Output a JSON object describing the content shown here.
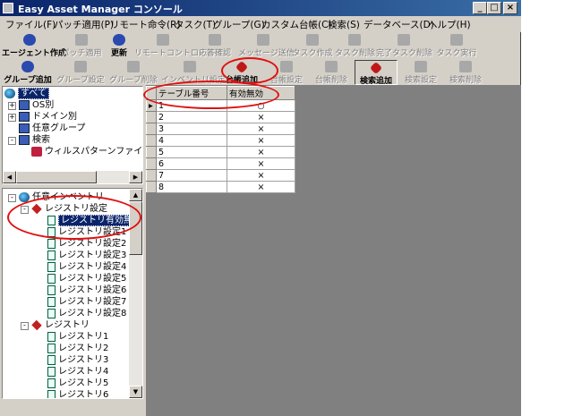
{
  "window": {
    "title": "Easy Asset Manager コンソール",
    "controls": {
      "minimize": "_",
      "maximize": "□",
      "close": "×"
    }
  },
  "menu": [
    {
      "label": "ファイル(F)"
    },
    {
      "label": "パッチ適用(P)"
    },
    {
      "label": "リモート命令(R)"
    },
    {
      "label": "タスク(T)"
    },
    {
      "label": "グループ(G)"
    },
    {
      "label": "カスタム台帳(C)"
    },
    {
      "label": "検索(S)"
    },
    {
      "label": "データベース(D)"
    },
    {
      "label": "ヘルプ(H)"
    }
  ],
  "toolbar1": [
    {
      "label": "エージェント作成",
      "enabled": true
    },
    {
      "label": "パッチ適用",
      "enabled": false
    },
    {
      "label": "更新",
      "enabled": true
    },
    {
      "label": "リモートコントロール",
      "enabled": false
    },
    {
      "label": "応答確認",
      "enabled": false
    },
    {
      "label": "メッセージ送信",
      "enabled": false
    },
    {
      "label": "タスク作成",
      "enabled": false
    },
    {
      "label": "タスク削除",
      "enabled": false
    },
    {
      "label": "完了タスク削除",
      "enabled": false
    },
    {
      "label": "タスク実行",
      "enabled": false
    }
  ],
  "toolbar2": [
    {
      "label": "グループ追加",
      "enabled": true
    },
    {
      "label": "グループ設定",
      "enabled": false
    },
    {
      "label": "グループ削除",
      "enabled": false
    },
    {
      "label": "インベントリ設定",
      "enabled": false
    },
    {
      "label": "台帳追加",
      "enabled": true
    },
    {
      "label": "台帳設定",
      "enabled": false
    },
    {
      "label": "台帳削除",
      "enabled": false
    },
    {
      "label": "検索追加",
      "enabled": true
    },
    {
      "label": "検索設定",
      "enabled": false
    },
    {
      "label": "検索削除",
      "enabled": false
    }
  ],
  "tree_top": [
    {
      "label": "すべて",
      "icon": "world-icon",
      "selected": true
    },
    {
      "label": "OS別",
      "icon": "computers-icon",
      "expander": "+"
    },
    {
      "label": "ドメイン別",
      "icon": "computers-icon",
      "expander": "+"
    },
    {
      "label": "任意グループ",
      "icon": "computers-icon"
    },
    {
      "label": "検索",
      "icon": "computers-icon",
      "expander": "-"
    },
    {
      "label": "ウィルスパターンファイルが古い",
      "icon": "search-icon"
    }
  ],
  "tree_bottom": [
    {
      "label": "任意インベントリ",
      "icon": "inventory-icon",
      "expander": "-"
    },
    {
      "label": "レジストリ設定",
      "icon": "registry-icon",
      "expander": "-"
    },
    {
      "label": "レジストリ有効無効",
      "icon": "doc-icon",
      "selected": true
    },
    {
      "label": "レジストリ設定1",
      "icon": "doc-icon"
    },
    {
      "label": "レジストリ設定2",
      "icon": "doc-icon"
    },
    {
      "label": "レジストリ設定3",
      "icon": "doc-icon"
    },
    {
      "label": "レジストリ設定4",
      "icon": "doc-icon"
    },
    {
      "label": "レジストリ設定5",
      "icon": "doc-icon"
    },
    {
      "label": "レジストリ設定6",
      "icon": "doc-icon"
    },
    {
      "label": "レジストリ設定7",
      "icon": "doc-icon"
    },
    {
      "label": "レジストリ設定8",
      "icon": "doc-icon"
    },
    {
      "label": "レジストリ",
      "icon": "registry-icon",
      "expander": "-"
    },
    {
      "label": "レジストリ1",
      "icon": "doc-icon"
    },
    {
      "label": "レジストリ2",
      "icon": "doc-icon"
    },
    {
      "label": "レジストリ3",
      "icon": "doc-icon"
    },
    {
      "label": "レジストリ4",
      "icon": "doc-icon"
    },
    {
      "label": "レジストリ5",
      "icon": "doc-icon"
    },
    {
      "label": "レジストリ6",
      "icon": "doc-icon"
    }
  ],
  "grid": {
    "columns": [
      "テーブル番号",
      "有効無効"
    ],
    "rows": [
      {
        "num": "1",
        "val": "○"
      },
      {
        "num": "2",
        "val": "×"
      },
      {
        "num": "3",
        "val": "×"
      },
      {
        "num": "4",
        "val": "×"
      },
      {
        "num": "5",
        "val": "×"
      },
      {
        "num": "6",
        "val": "×"
      },
      {
        "num": "7",
        "val": "×"
      },
      {
        "num": "8",
        "val": "×"
      }
    ]
  },
  "annotation_color": "#e01010"
}
